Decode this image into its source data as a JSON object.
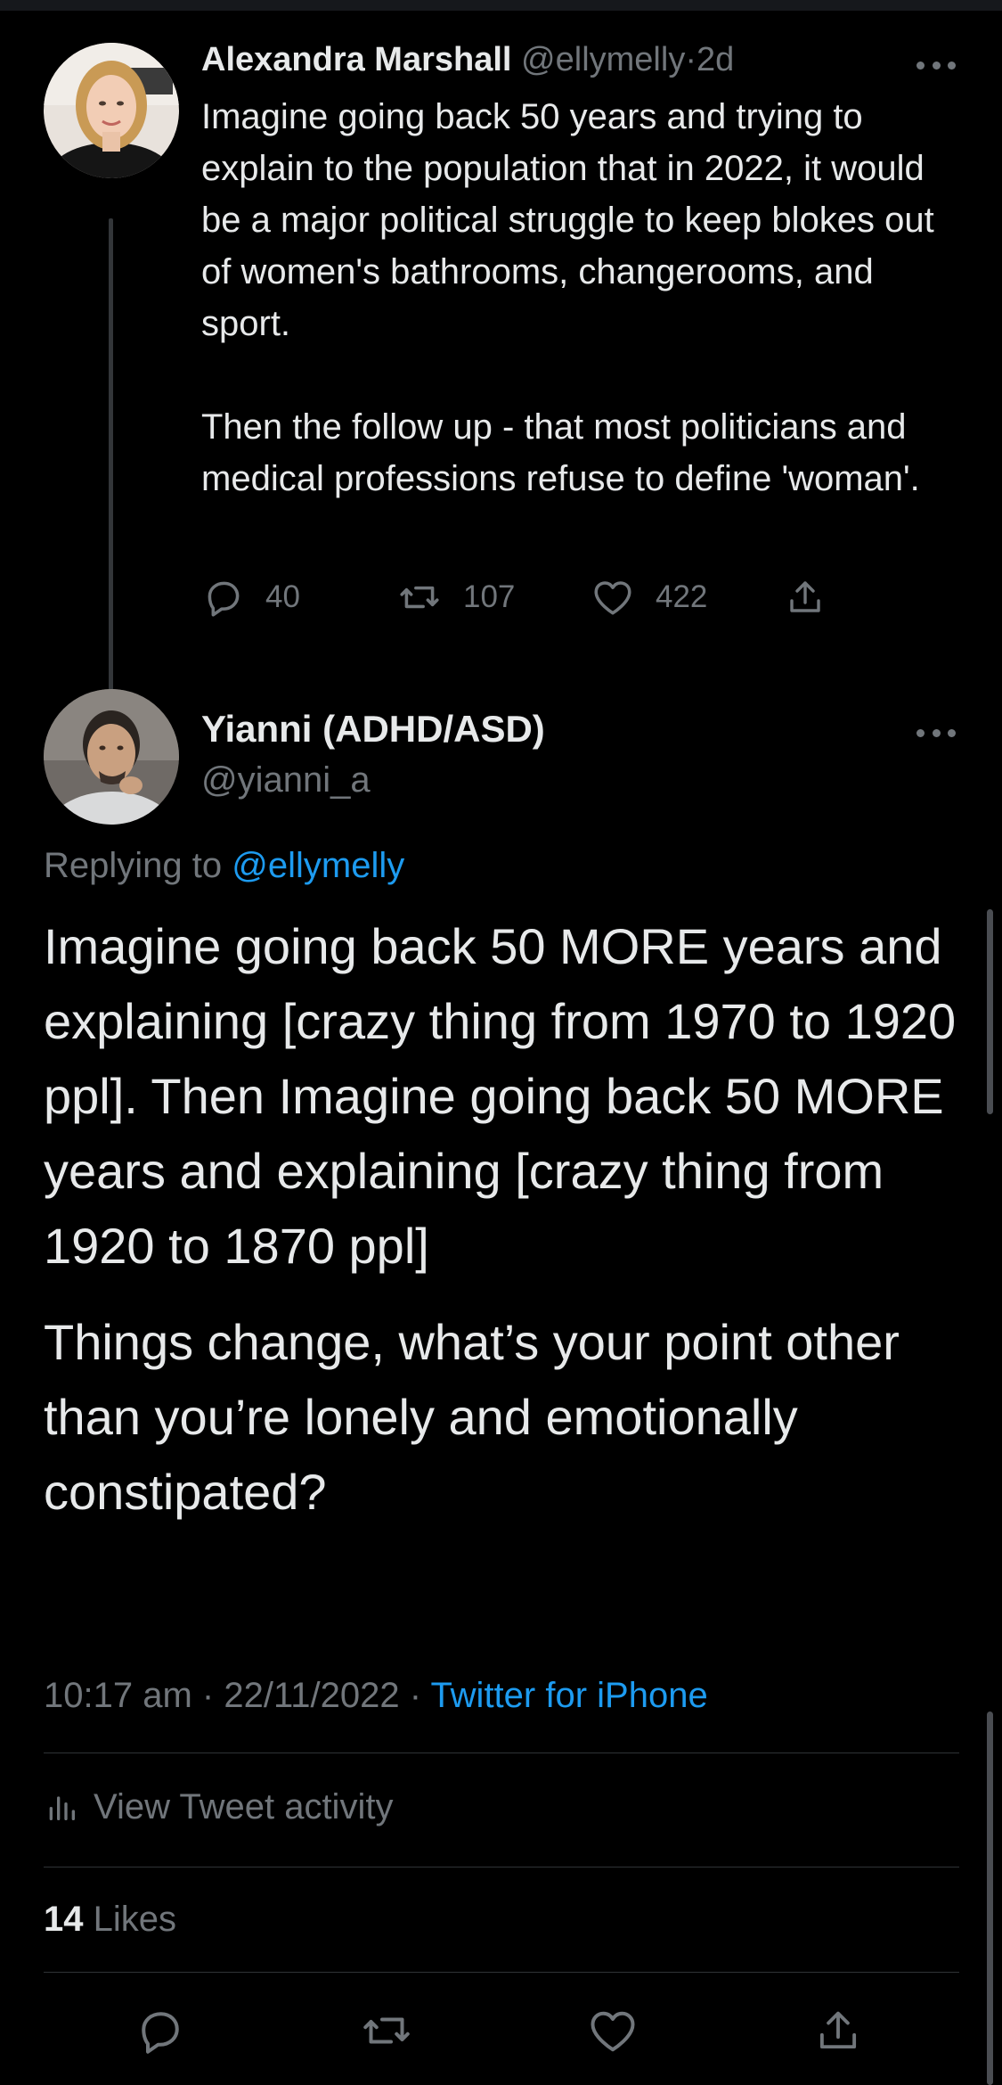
{
  "colors": {
    "background": "#000000",
    "text": "#e7e9ea",
    "muted": "#71767b",
    "link": "#1d9bf0",
    "divider": "#2f3336"
  },
  "parent_tweet": {
    "name": "Alexandra Marshall",
    "handle": "@ellymelly",
    "separator": "·",
    "time": "2d",
    "text": "Imagine going back 50 years and trying to explain to the population that in 2022, it would be a major political struggle to keep blokes out of women's bathrooms, changerooms, and sport.\n\nThen the follow up - that most politicians and medical professions refuse to define 'woman'.",
    "replies": "40",
    "retweets": "107",
    "likes": "422",
    "icons": {
      "avatar": "avatar-photo",
      "more": "more-options-icon",
      "reply": "reply-icon",
      "retweet": "retweet-icon",
      "like": "heart-icon",
      "share": "share-icon"
    }
  },
  "main_tweet": {
    "name": "Yianni (ADHD/ASD)",
    "handle": "@yianni_a",
    "replying_prefix": "Replying to",
    "replying_to": "@ellymelly",
    "paragraphs": [
      "Imagine going back 50 MORE years and explaining [crazy thing from 1970 to 1920 ppl]. Then Imagine going back 50 MORE years and explaining [crazy thing from 1920 to 1870 ppl]",
      "Things change, what’s your point other than you’re lonely and emotionally constipated?"
    ],
    "time": "10:17 am",
    "separator": "·",
    "date": "22/11/2022",
    "source": "Twitter for iPhone",
    "activity_label": "View Tweet activity",
    "likes_count": "14",
    "likes_label": "Likes",
    "icons": {
      "activity": "analytics-icon",
      "reply": "reply-icon",
      "retweet": "retweet-icon",
      "like": "heart-icon",
      "share": "share-icon"
    }
  }
}
